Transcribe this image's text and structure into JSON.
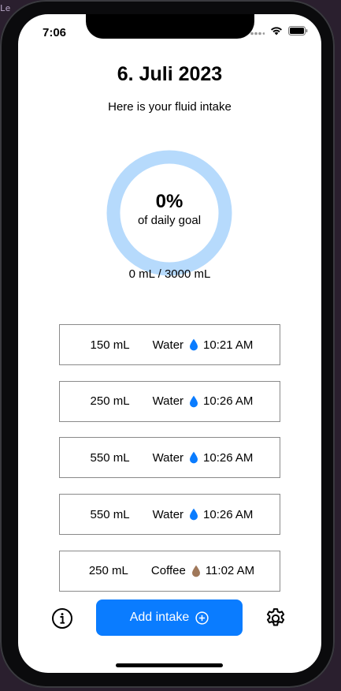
{
  "desktop": {
    "fragment": "Le"
  },
  "status_bar": {
    "time": "7:06"
  },
  "header": {
    "date": "6. Juli 2023",
    "subtitle": "Here is your fluid intake"
  },
  "progress": {
    "percent_label": "0%",
    "caption": "of daily goal",
    "fraction": 0,
    "ring_color": "#b6dafc",
    "fill_color": "#0a7cff",
    "total_label": "0 mL / 3000 mL"
  },
  "entries": [
    {
      "amount": "150 mL",
      "type": "Water",
      "icon": "water-drop-icon",
      "icon_color": "#0a7cff",
      "time": "10:21 AM"
    },
    {
      "amount": "250 mL",
      "type": "Water",
      "icon": "water-drop-icon",
      "icon_color": "#0a7cff",
      "time": "10:26 AM"
    },
    {
      "amount": "550 mL",
      "type": "Water",
      "icon": "water-drop-icon",
      "icon_color": "#0a7cff",
      "time": "10:26 AM"
    },
    {
      "amount": "550 mL",
      "type": "Water",
      "icon": "water-drop-icon",
      "icon_color": "#0a7cff",
      "time": "10:26 AM"
    },
    {
      "amount": "250 mL",
      "type": "Coffee",
      "icon": "coffee-drop-icon",
      "icon_color": "#a0785a",
      "time": "11:02 AM"
    }
  ],
  "toolbar": {
    "info_icon": "info-icon",
    "add_label": "Add intake",
    "add_icon": "plus-circle-icon",
    "settings_icon": "gear-icon",
    "accent": "#0a7cff"
  }
}
